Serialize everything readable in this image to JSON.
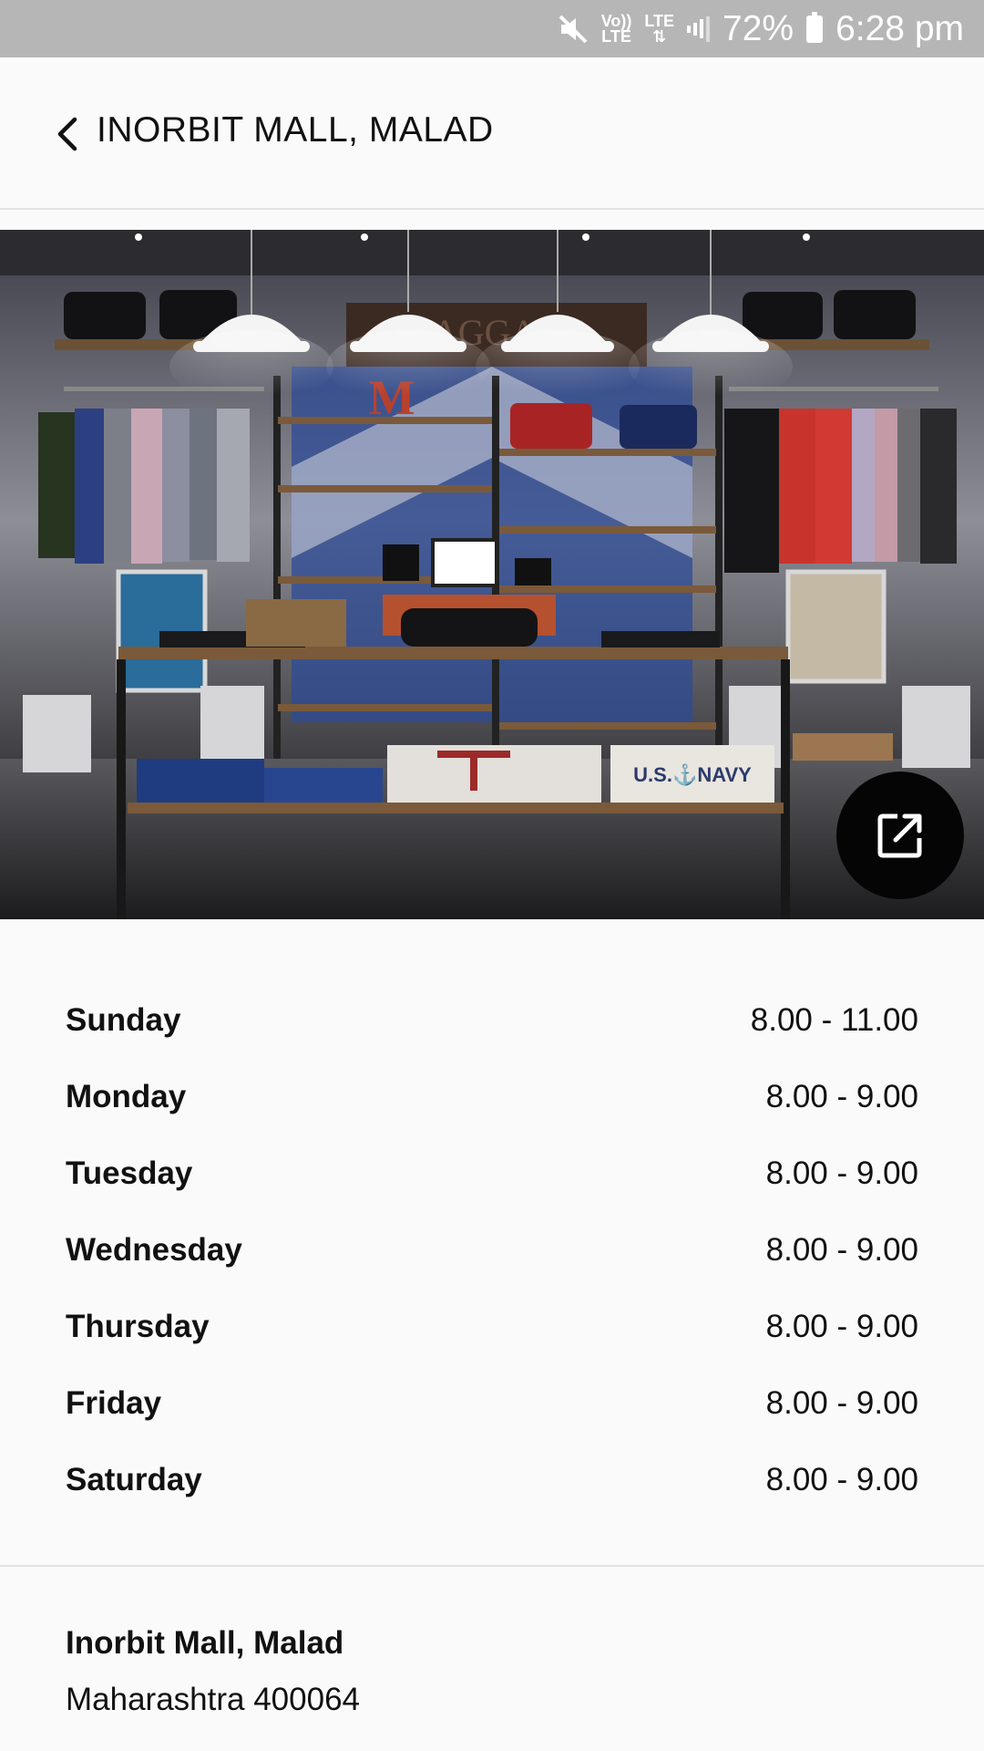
{
  "status_bar": {
    "mute_icon": "mute-icon",
    "volte_label_top": "Vo))",
    "volte_label_bottom": "LTE",
    "lte_label": "LTE",
    "battery_percent": "72%",
    "clock": "6:28 pm"
  },
  "header": {
    "back_icon": "chevron-left-icon",
    "title": "INORBIT MALL, MALAD"
  },
  "hero": {
    "image_name": "store-interior-photo",
    "open_icon": "open-external-icon",
    "sign_text": "BAGGAGE",
    "shirt_text": "U.S.⚓NAVY"
  },
  "hours": [
    {
      "day": "Sunday",
      "time": "8.00 - 11.00"
    },
    {
      "day": "Monday",
      "time": "8.00 - 9.00"
    },
    {
      "day": "Tuesday",
      "time": "8.00 - 9.00"
    },
    {
      "day": "Wednesday",
      "time": "8.00 - 9.00"
    },
    {
      "day": "Thursday",
      "time": "8.00 - 9.00"
    },
    {
      "day": "Friday",
      "time": "8.00 - 9.00"
    },
    {
      "day": "Saturday",
      "time": "8.00 - 9.00"
    }
  ],
  "address": {
    "name": "Inorbit Mall, Malad",
    "line1": "Maharashtra 400064"
  },
  "colors": {
    "status_bar": "#b6b6b6",
    "background": "#fafafa",
    "fab": "#050505",
    "divider": "#e3e3e3"
  }
}
